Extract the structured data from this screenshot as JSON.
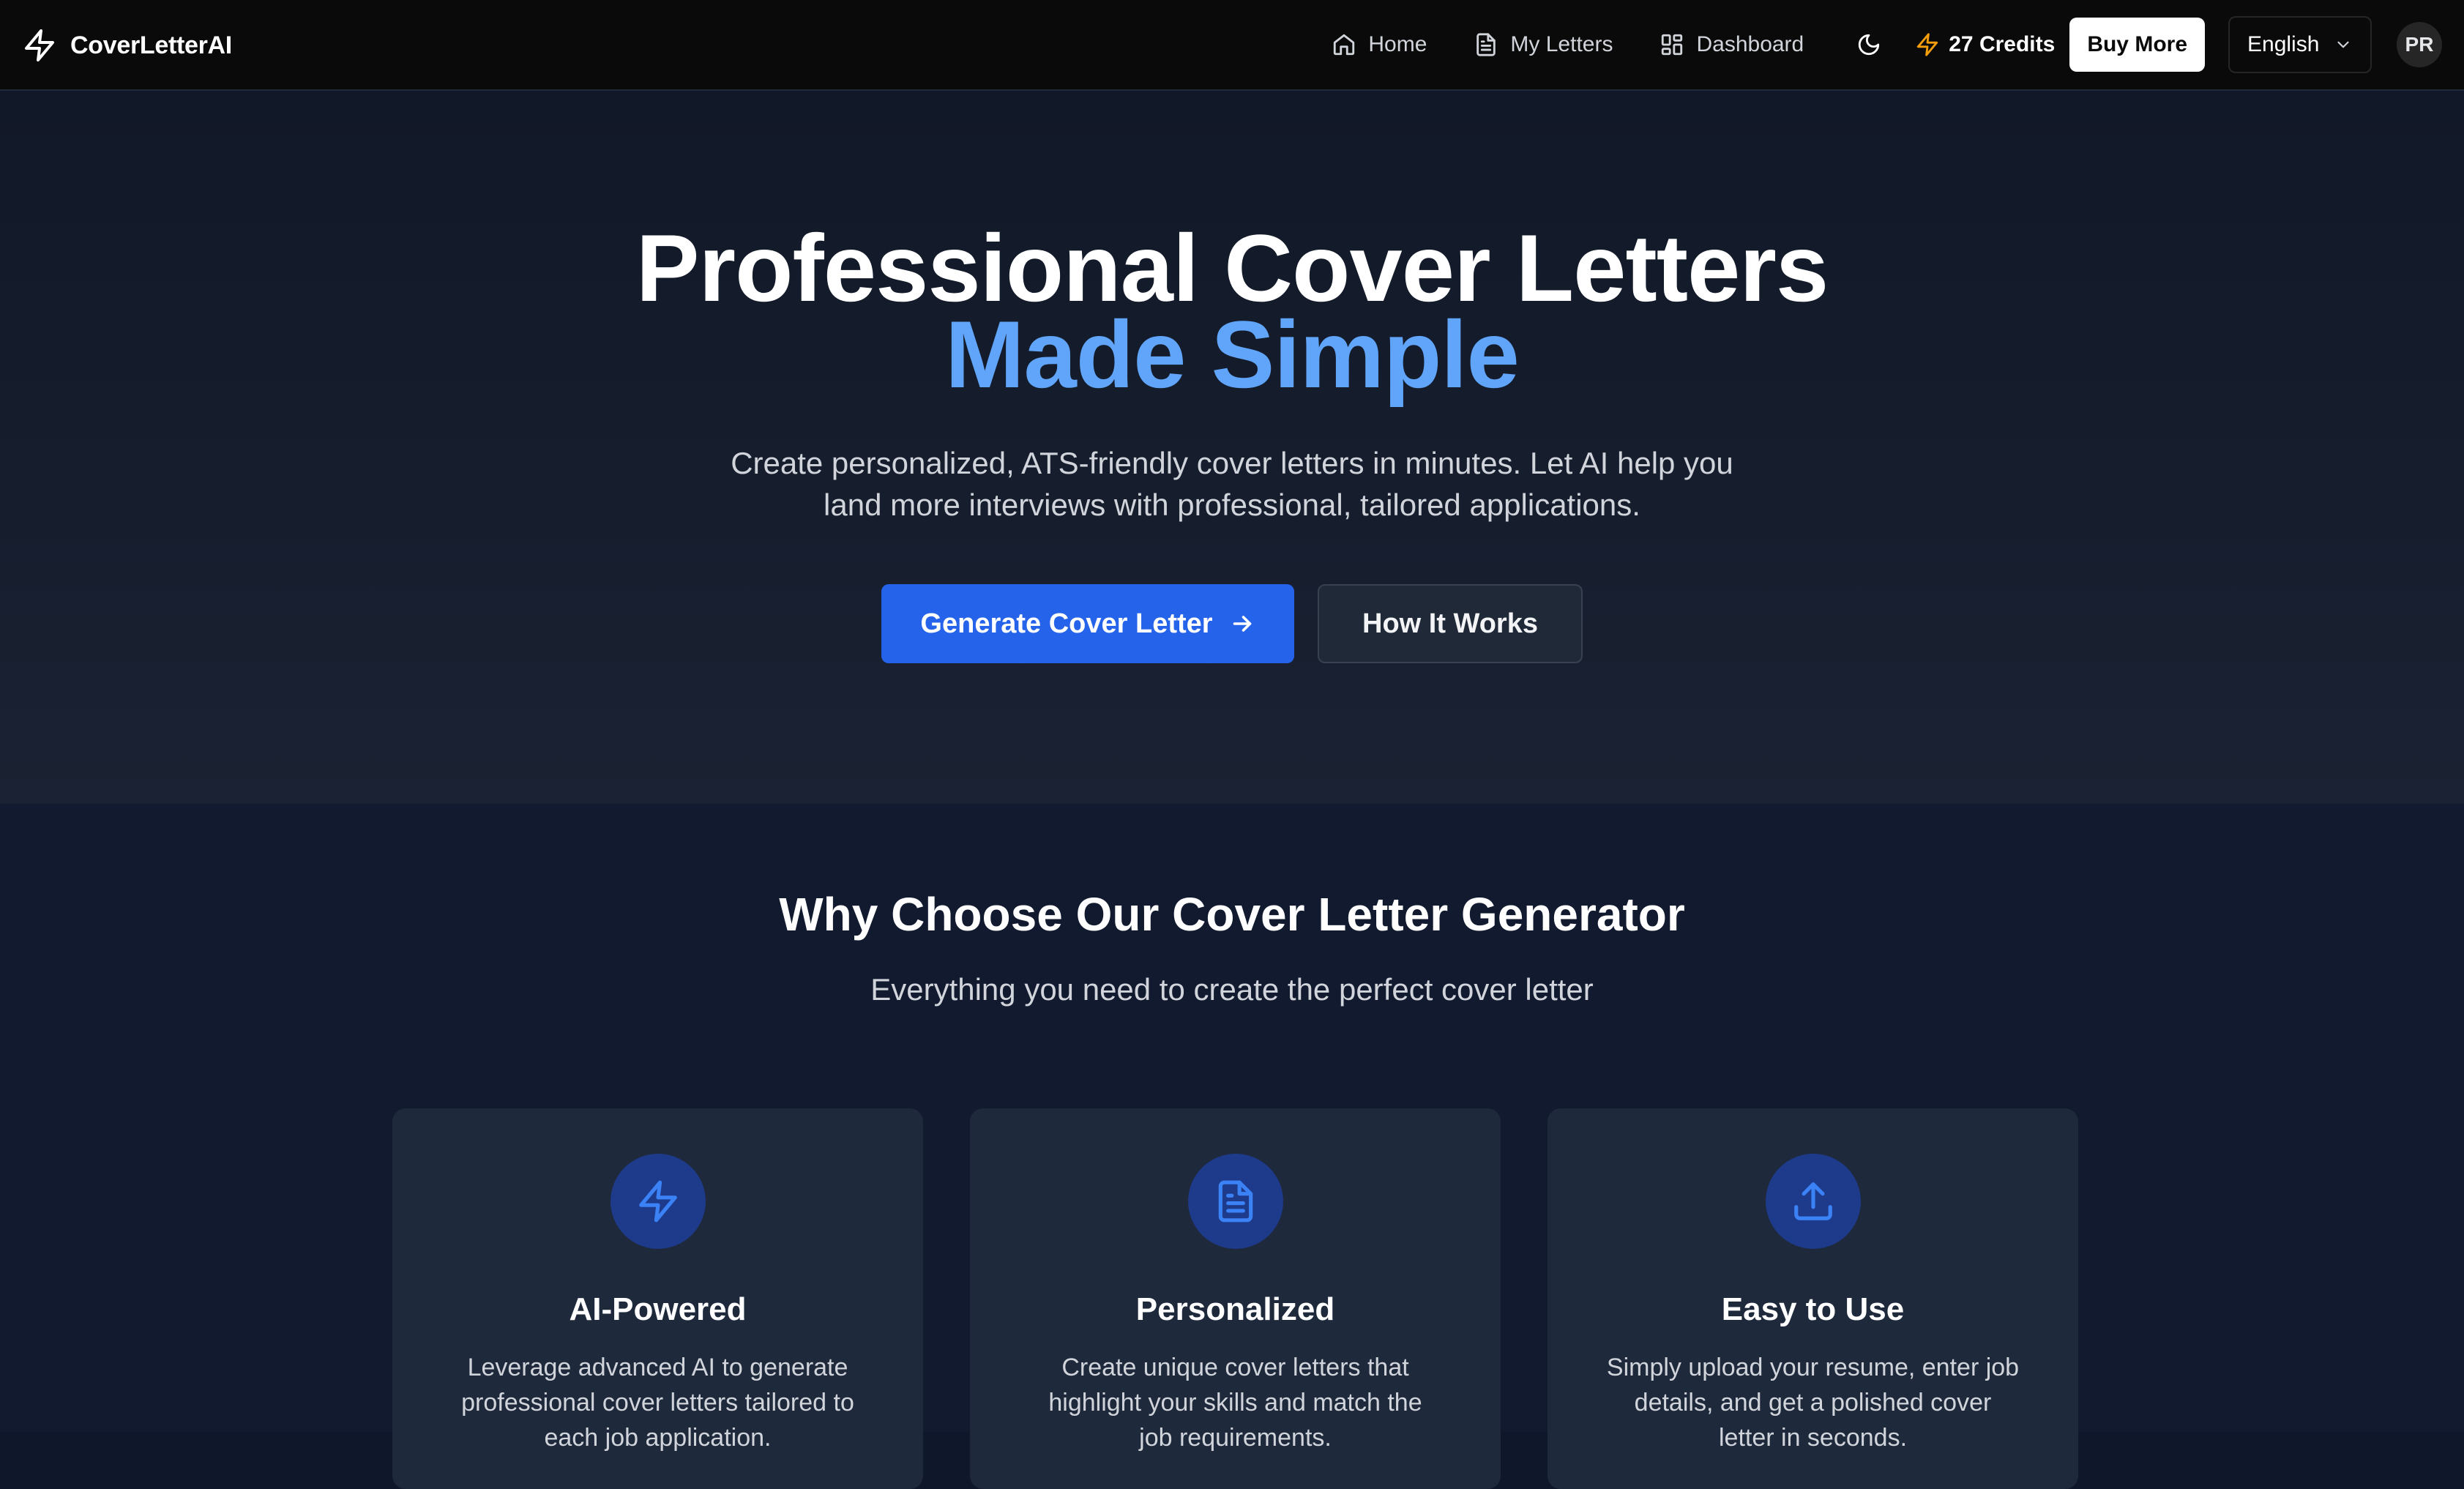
{
  "brand": {
    "name": "CoverLetterAI",
    "icon": "zap-icon"
  },
  "nav": {
    "links": [
      {
        "label": "Home",
        "icon": "home-icon"
      },
      {
        "label": "My Letters",
        "icon": "file-text-icon"
      },
      {
        "label": "Dashboard",
        "icon": "dashboard-grid-icon"
      }
    ],
    "theme_icon": "moon-icon",
    "credits_label": "27 Credits",
    "buy_more_label": "Buy More",
    "language": "English",
    "avatar_initials": "PR"
  },
  "hero": {
    "title_line1": "Professional Cover Letters",
    "title_line2": "Made Simple",
    "subtitle": "Create personalized, ATS-friendly cover letters in minutes. Let AI help you land more interviews with professional, tailored applications.",
    "primary_button": "Generate Cover Letter",
    "secondary_button": "How It Works"
  },
  "features": {
    "title": "Why Choose Our Cover Letter Generator",
    "subtitle": "Everything you need to create the perfect cover letter",
    "cards": [
      {
        "icon": "zap-icon",
        "title": "AI-Powered",
        "description": "Leverage advanced AI to generate professional cover letters tailored to each job application."
      },
      {
        "icon": "file-text-icon",
        "title": "Personalized",
        "description": "Create unique cover letters that highlight your skills and match the job requirements."
      },
      {
        "icon": "upload-icon",
        "title": "Easy to Use",
        "description": "Simply upload your resume, enter job details, and get a polished cover letter in seconds."
      }
    ]
  },
  "colors": {
    "accent": "#60a5fa",
    "primary_button": "#2563eb",
    "credits_icon": "#f59e0b",
    "navbar_bg": "#0a0a0a",
    "hero_bg": "#111827",
    "card_bg": "#1e293b",
    "icon_circle": "#1e3a8a"
  }
}
